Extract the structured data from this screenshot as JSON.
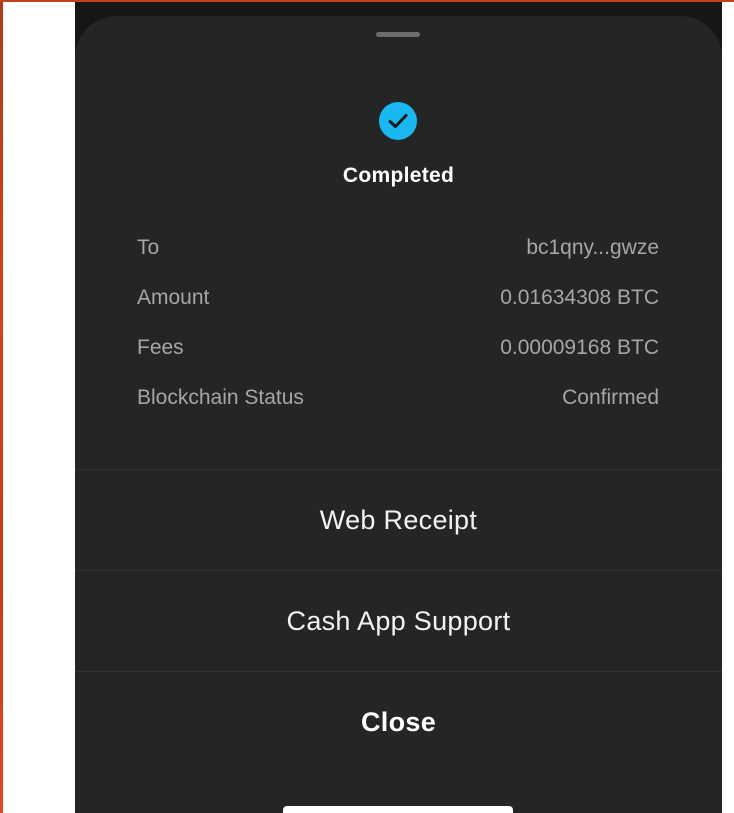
{
  "colors": {
    "sheet_background": "#242525",
    "status_accent": "#19b8f0",
    "primary_text": "#ffffff",
    "secondary_text": "#a6a6a6"
  },
  "status": {
    "icon": "check-circle-icon",
    "title": "Completed"
  },
  "details": [
    {
      "label": "To",
      "value": "bc1qny...gwze"
    },
    {
      "label": "Amount",
      "value": "0.01634308 BTC"
    },
    {
      "label": "Fees",
      "value": "0.00009168 BTC"
    },
    {
      "label": "Blockchain Status",
      "value": "Confirmed"
    }
  ],
  "actions": {
    "web_receipt": "Web Receipt",
    "support": "Cash App Support",
    "close": "Close"
  }
}
